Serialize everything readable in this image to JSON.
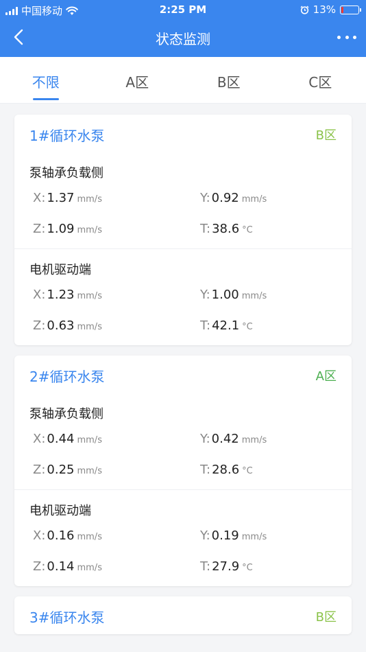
{
  "status_bar": {
    "carrier": "中国移动",
    "time": "2:25 PM",
    "battery": "13%",
    "battery_color": "#ff3b30",
    "icons": [
      "signal-icon",
      "wifi-icon",
      "alarm-icon",
      "battery-icon"
    ]
  },
  "nav": {
    "title": "状态监测",
    "back_icon": "chevron-left-icon",
    "more_icon": "more-dots-icon"
  },
  "tabs": [
    {
      "label": "不限",
      "active": true
    },
    {
      "label": "A区",
      "active": false
    },
    {
      "label": "B区",
      "active": false
    },
    {
      "label": "C区",
      "active": false
    }
  ],
  "colors": {
    "accent": "#3a86ee",
    "zone_b": "#8bc34a",
    "zone_a": "#4caf50"
  },
  "cards": [
    {
      "name": "1#循环水泵",
      "zone": "B区",
      "sections": [
        {
          "title": "泵轴承负载侧",
          "readings": [
            {
              "label": "X:",
              "value": "1.37",
              "unit": "mm/s"
            },
            {
              "label": "Y:",
              "value": "0.92",
              "unit": "mm/s"
            },
            {
              "label": "Z:",
              "value": "1.09",
              "unit": "mm/s"
            },
            {
              "label": "T:",
              "value": "38.6",
              "unit": "°C"
            }
          ]
        },
        {
          "title": "电机驱动端",
          "readings": [
            {
              "label": "X:",
              "value": "1.23",
              "unit": "mm/s"
            },
            {
              "label": "Y:",
              "value": "1.00",
              "unit": "mm/s"
            },
            {
              "label": "Z:",
              "value": "0.63",
              "unit": "mm/s"
            },
            {
              "label": "T:",
              "value": "42.1",
              "unit": "°C"
            }
          ]
        }
      ]
    },
    {
      "name": "2#循环水泵",
      "zone": "A区",
      "sections": [
        {
          "title": "泵轴承负载侧",
          "readings": [
            {
              "label": "X:",
              "value": "0.44",
              "unit": "mm/s"
            },
            {
              "label": "Y:",
              "value": "0.42",
              "unit": "mm/s"
            },
            {
              "label": "Z:",
              "value": "0.25",
              "unit": "mm/s"
            },
            {
              "label": "T:",
              "value": "28.6",
              "unit": "°C"
            }
          ]
        },
        {
          "title": "电机驱动端",
          "readings": [
            {
              "label": "X:",
              "value": "0.16",
              "unit": "mm/s"
            },
            {
              "label": "Y:",
              "value": "0.19",
              "unit": "mm/s"
            },
            {
              "label": "Z:",
              "value": "0.14",
              "unit": "mm/s"
            },
            {
              "label": "T:",
              "value": "27.9",
              "unit": "°C"
            }
          ]
        }
      ]
    },
    {
      "name": "3#循环水泵",
      "zone": "B区",
      "sections": []
    }
  ]
}
